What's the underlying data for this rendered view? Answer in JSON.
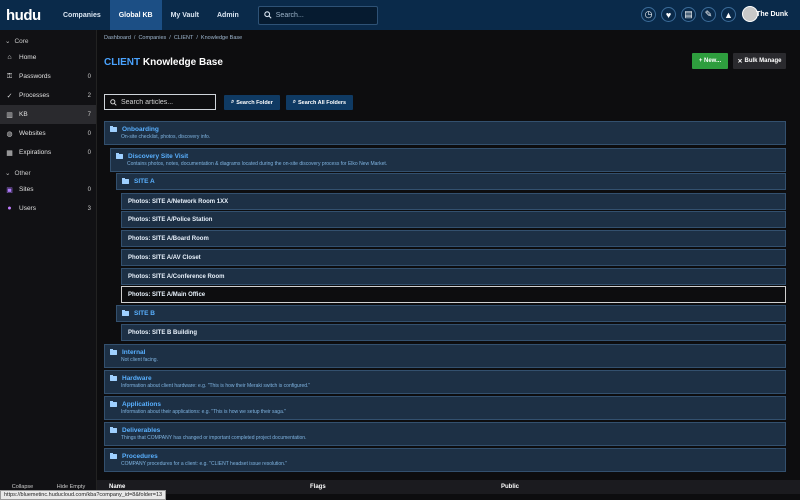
{
  "topbar": {
    "logo": "hudu",
    "nav": [
      "Companies",
      "Global KB",
      "My Vault",
      "Admin"
    ],
    "search_placeholder": "Search...",
    "user_name": "The Dunk"
  },
  "sidebar": {
    "core_label": "Core",
    "items": [
      {
        "label": "Home",
        "count": ""
      },
      {
        "label": "Passwords",
        "count": "0"
      },
      {
        "label": "Processes",
        "count": "2"
      },
      {
        "label": "KB",
        "count": "7"
      },
      {
        "label": "Websites",
        "count": "0"
      },
      {
        "label": "Expirations",
        "count": "0"
      }
    ],
    "other_label": "Other",
    "other_items": [
      {
        "label": "Sites",
        "count": "0"
      },
      {
        "label": "Users",
        "count": "3"
      }
    ],
    "footer": [
      "Collapse",
      "Hide Empty"
    ]
  },
  "breadcrumb": [
    "Dashboard",
    "/",
    "Companies",
    "/",
    "CLIENT",
    "/",
    "Knowledge Base"
  ],
  "page": {
    "title_client": "CLIENT",
    "title_rest": "Knowledge Base",
    "new_button": "+ New...",
    "bulk_button": "Bulk Manage",
    "search_placeholder": "Search articles...",
    "search_folder": "Search Folder",
    "search_all": "Search All Folders"
  },
  "folders": {
    "onboarding": {
      "name": "Onboarding",
      "desc": "On-site checklist, photos, discovery info."
    },
    "discovery": {
      "name": "Discovery Site Visit",
      "desc": "Contains photos, notes, documentation & diagrams located during the on-site discovery process for Elko New Market."
    },
    "site_a": {
      "name": "SITE A"
    },
    "site_a_articles": [
      "Photos: SITE A/Network Room 1XX",
      "Photos: SITE A/Police Station",
      "Photos: SITE A/Board Room",
      "Photos: SITE A/AV Closet",
      "Photos: SITE A/Conference Room",
      "Photos: SITE A/Main Office"
    ],
    "site_b": {
      "name": "SITE B"
    },
    "site_b_articles": [
      "Photos: SITE B Building"
    ],
    "internal": {
      "name": "Internal",
      "desc": "Not client facing."
    },
    "hardware": {
      "name": "Hardware",
      "desc": "Information about client hardware: e.g. \"This is how their Meraki switch is configured.\""
    },
    "applications": {
      "name": "Applications",
      "desc": "Information about their applications: e.g. \"This is how we setup their saga.\""
    },
    "deliverables": {
      "name": "Deliverables",
      "desc": "Things that COMPANY has changed or important completed project documentation."
    },
    "procedures": {
      "name": "Procedures",
      "desc": "COMPANY procedures for a client: e.g. \"CLIENT headset issue resolution.\""
    }
  },
  "table_headers": [
    "Name",
    "Flags",
    "Public"
  ],
  "status_url": "https://bluemetinc.huducloud.com/kba?company_id=8&folder=13"
}
